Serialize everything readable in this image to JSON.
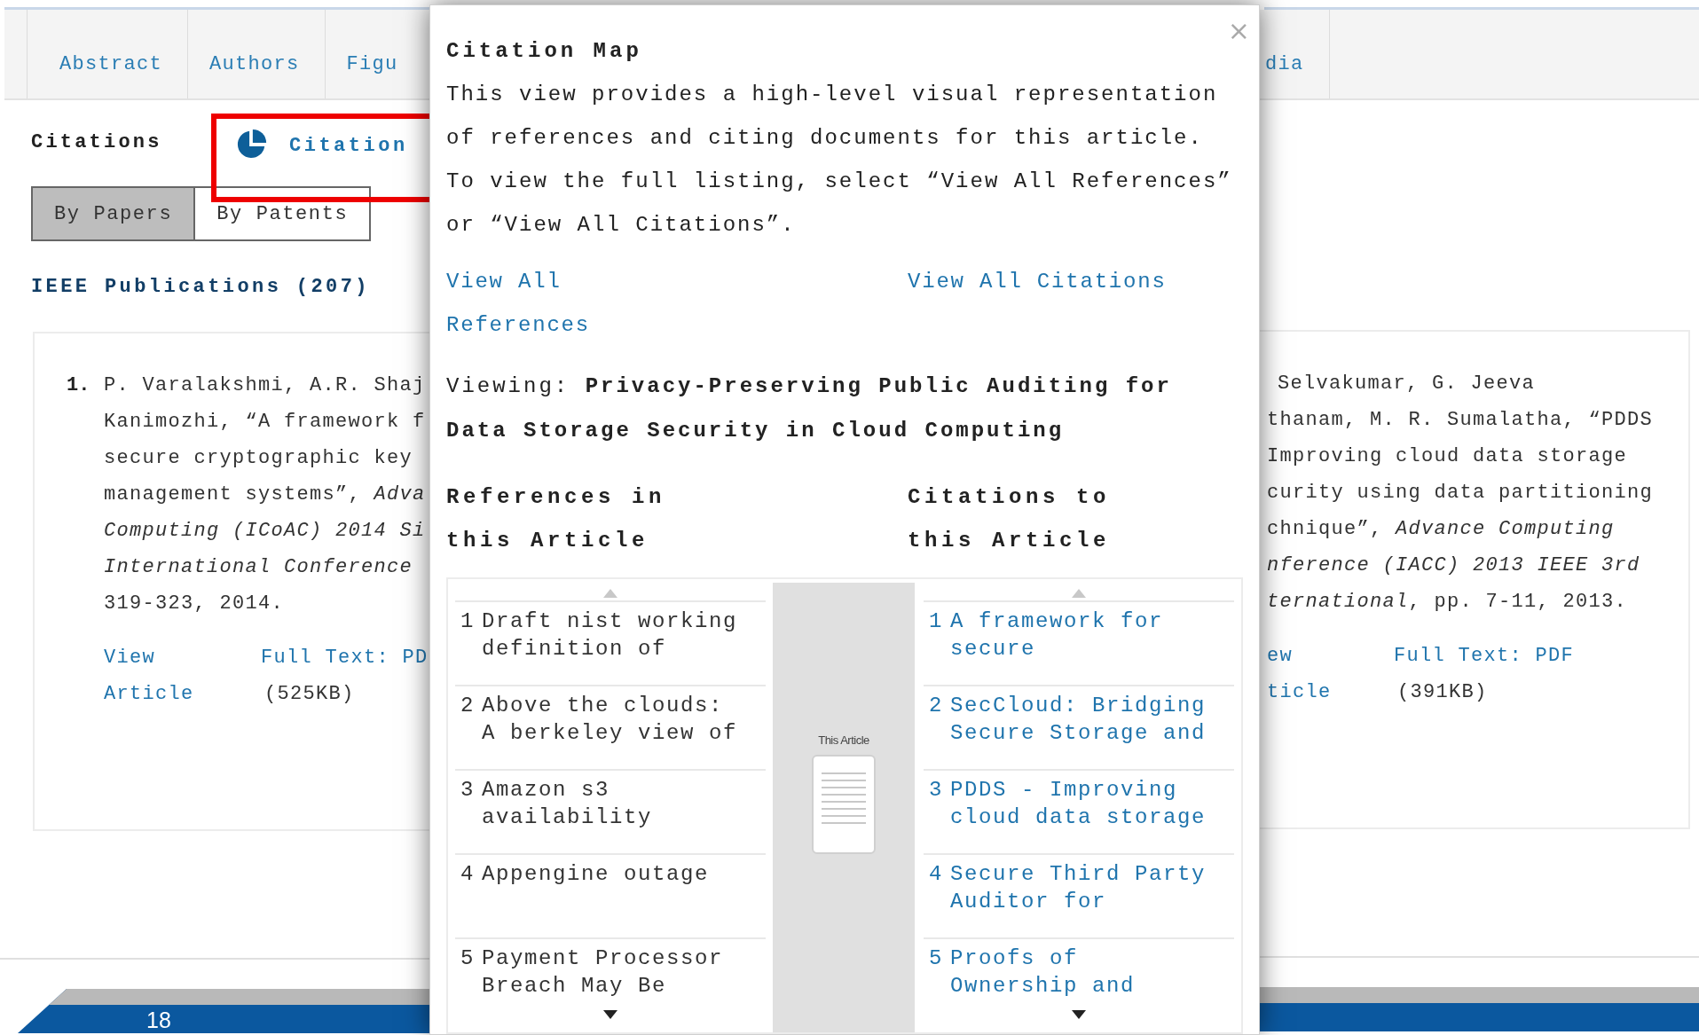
{
  "page": {
    "tabs": [
      "Abstract",
      "Authors",
      "Figu"
    ],
    "tabs_right_of_popup": [
      "dia"
    ],
    "section_title": "Citations",
    "citation_map_link": {
      "label": "Citation",
      "highlighted": true
    },
    "view_toggle": [
      {
        "label": "By Papers",
        "selected": true
      },
      {
        "label": "By Patents",
        "selected": false
      }
    ],
    "publications_heading": "IEEE Publications (207)",
    "results": [
      {
        "number": "1.",
        "lines": [
          "P. Varalakshmi, A.R. Shaj",
          "Kanimozhi, “A framework f",
          "secure cryptographic key",
          "management systems”, *Adva*",
          "*Computing (ICoAC) 2014 Si*",
          "*International Conference*",
          "319-323, 2014."
        ],
        "view_link": [
          "View",
          "Article"
        ],
        "pdf_link": "Full Text: PD",
        "pdf_size": "(525KB)"
      },
      {
        "lines": [
          "Selvakumar, G. Jeeva",
          "thanam, M. R. Sumalatha, “PDDS",
          "Improving cloud data storage",
          "curity using data partitioning",
          "chnique”, *Advance Computing*",
          "*nference (IACC) 2013 IEEE 3rd*",
          "*ternational*, pp. 7-11, 2013."
        ],
        "view_link": [
          "ew",
          "ticle"
        ],
        "pdf_link": "Full Text: PDF",
        "pdf_size": "(391KB)"
      }
    ],
    "slide_number": "18"
  },
  "popup": {
    "title": "Citation Map",
    "close": "×",
    "description": "This view provides a high-level visual representation of references and citing documents for this article. To view the full listing, select “View All References” or “View All Citations”.",
    "links": [
      "View All References",
      "View All Citations"
    ],
    "viewing": "Viewing: **Privacy-Preserving Public Auditing for Data Storage Security in Cloud Computing**",
    "headings": [
      "References in this Article",
      "Citations to this Article"
    ],
    "center_label": "This Article",
    "references": [
      {
        "number": "1",
        "title": "Draft nist working definition of"
      },
      {
        "number": "2",
        "title": "Above the clouds: A berkeley view of"
      },
      {
        "number": "3",
        "title": "Amazon s3 availability"
      },
      {
        "number": "4",
        "title": "Appengine outage"
      },
      {
        "number": "5",
        "title": "Payment Processor Breach May Be"
      }
    ],
    "citations": [
      {
        "number": "1",
        "title": "A framework for secure"
      },
      {
        "number": "2",
        "title": "SecCloud: Bridging Secure Storage and"
      },
      {
        "number": "3",
        "title": "PDDS - Improving cloud data storage"
      },
      {
        "number": "4",
        "title": "Secure Third Party Auditor for"
      },
      {
        "number": "5",
        "title": "Proofs of Ownership and"
      }
    ]
  }
}
